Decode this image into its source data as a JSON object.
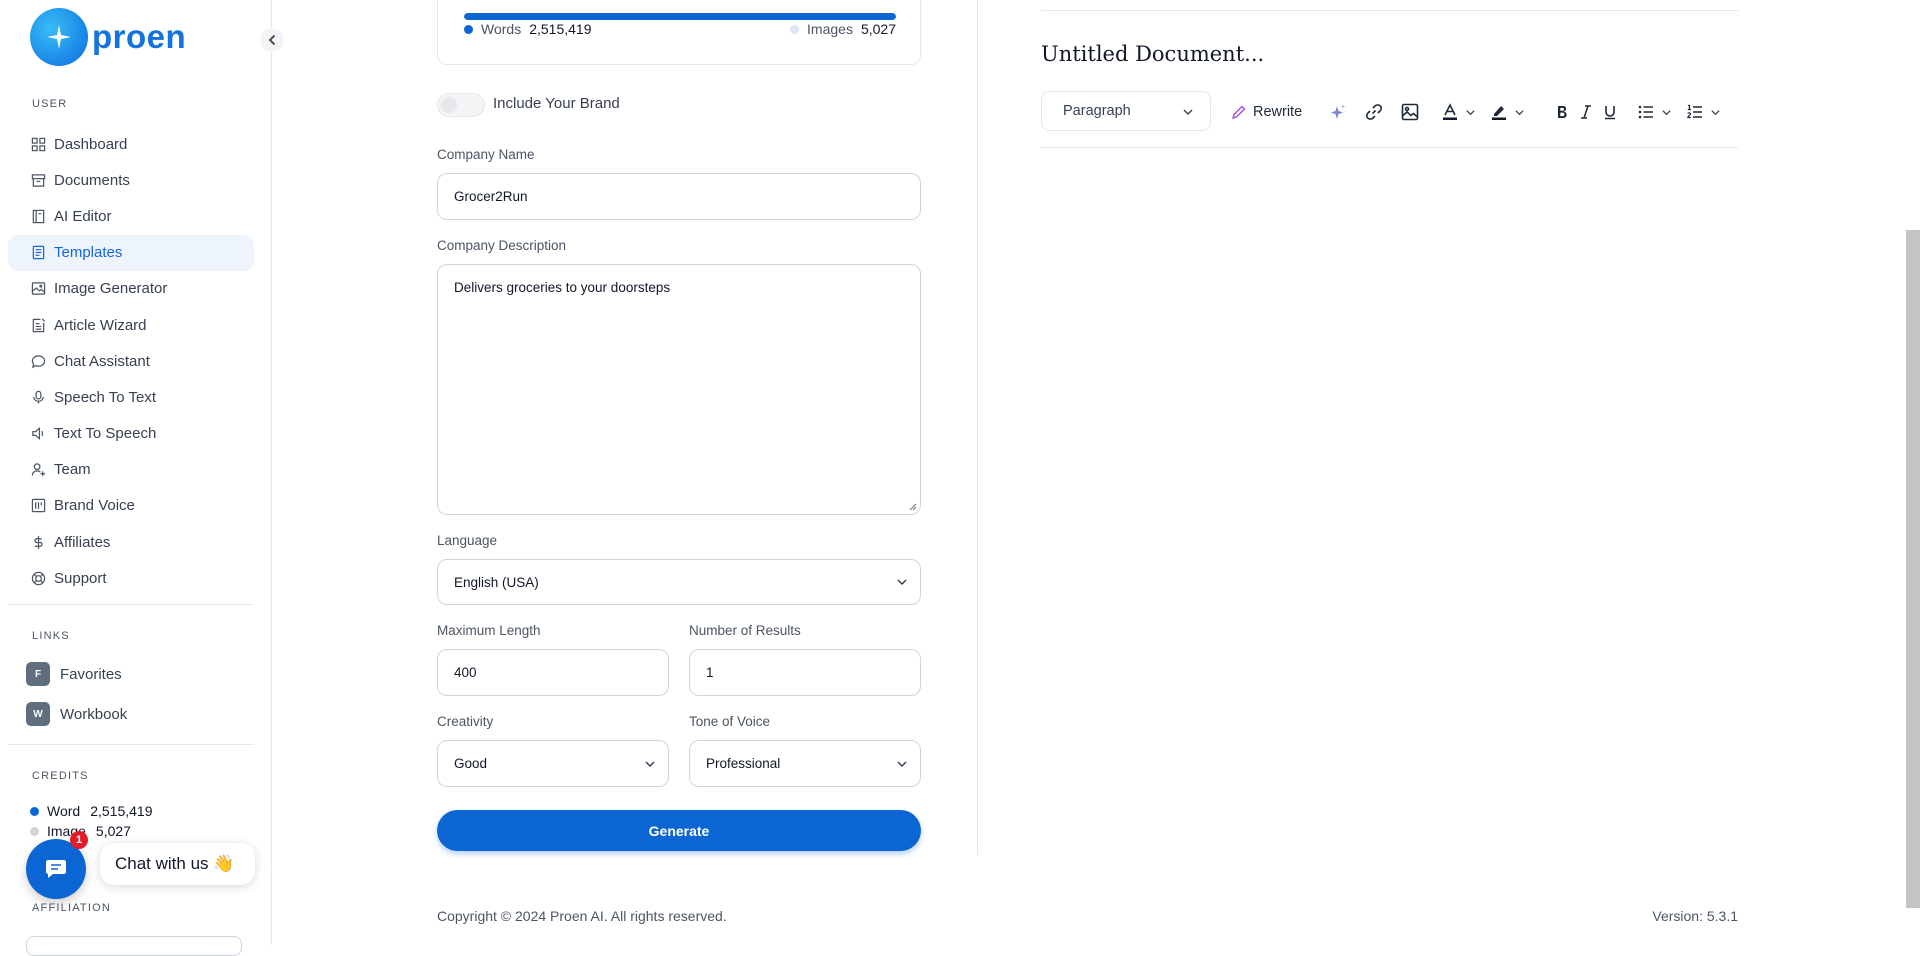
{
  "brand": {
    "name": "proen"
  },
  "sidebar": {
    "user_label": "USER",
    "items": [
      {
        "label": "Dashboard",
        "icon": "grid-icon"
      },
      {
        "label": "Documents",
        "icon": "archive-icon"
      },
      {
        "label": "AI Editor",
        "icon": "book-icon"
      },
      {
        "label": "Templates",
        "icon": "file-text-icon",
        "active": true
      },
      {
        "label": "Image Generator",
        "icon": "image-icon"
      },
      {
        "label": "Article Wizard",
        "icon": "article-icon"
      },
      {
        "label": "Chat Assistant",
        "icon": "message-circle-icon"
      },
      {
        "label": "Speech To Text",
        "icon": "microphone-icon"
      },
      {
        "label": "Text To Speech",
        "icon": "volume-icon"
      },
      {
        "label": "Team",
        "icon": "user-plus-icon"
      },
      {
        "label": "Brand Voice",
        "icon": "brand-icon"
      },
      {
        "label": "Affiliates",
        "icon": "dollar-icon"
      },
      {
        "label": "Support",
        "icon": "lifebuoy-icon"
      }
    ],
    "links_label": "LINKS",
    "links": [
      {
        "badge": "F",
        "label": "Favorites"
      },
      {
        "badge": "W",
        "label": "Workbook"
      }
    ],
    "credits_label": "CREDITS",
    "credits": {
      "word_label": "Word",
      "word_value": "2,515,419",
      "image_label": "Image",
      "image_value": "5,027"
    },
    "affiliation_label": "AFFILIATION"
  },
  "chat_widget": {
    "label": "Chat with us 👋",
    "badge": "1"
  },
  "form": {
    "usage": {
      "words_label": "Words",
      "words_value": "2,515,419",
      "images_label": "Images",
      "images_value": "5,027",
      "words_fill": 1.0
    },
    "include_brand_label": "Include Your Brand",
    "company_name_label": "Company Name",
    "company_name_value": "Grocer2Run",
    "company_desc_label": "Company Description",
    "company_desc_value": "Delivers groceries to your doorsteps",
    "language_label": "Language",
    "language_value": "English (USA)",
    "max_length_label": "Maximum Length",
    "max_length_value": "400",
    "num_results_label": "Number of Results",
    "num_results_value": "1",
    "creativity_label": "Creativity",
    "creativity_value": "Good",
    "tone_label": "Tone of Voice",
    "tone_value": "Professional",
    "generate_label": "Generate"
  },
  "editor": {
    "title": "Untitled Document...",
    "paragraph_label": "Paragraph",
    "rewrite_label": "Rewrite"
  },
  "footer": {
    "copyright": "Copyright © 2024 Proen AI. All rights reserved.",
    "version": "Version: 5.3.1"
  },
  "colors": {
    "accent": "#0b66d4",
    "active_bg": "#eef4fc"
  }
}
